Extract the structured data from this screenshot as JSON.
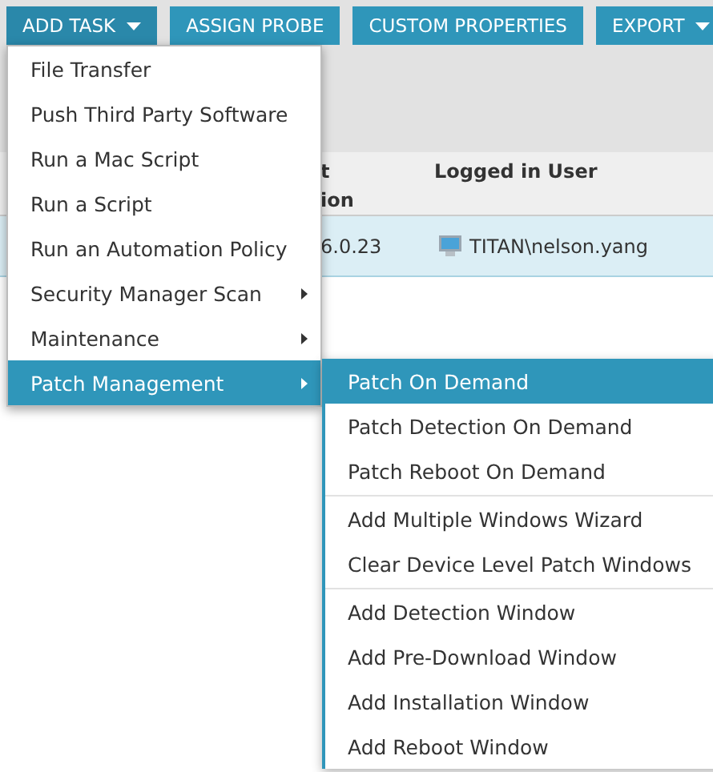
{
  "toolbar": {
    "buttons": [
      {
        "label": "ADD TASK",
        "dropdown": true,
        "open": true
      },
      {
        "label": "ASSIGN PROBE",
        "dropdown": false,
        "open": false
      },
      {
        "label": "CUSTOM PROPERTIES",
        "dropdown": false,
        "open": false
      },
      {
        "label": "EXPORT",
        "dropdown": true,
        "open": false
      }
    ]
  },
  "table": {
    "columns": [
      {
        "label": "t\nion"
      },
      {
        "label": "Logged in User"
      }
    ],
    "rows": [
      {
        "selected": true,
        "cells": [
          "6.0.23",
          "TITAN\\nelson.yang"
        ]
      }
    ]
  },
  "menu": {
    "items": [
      {
        "label": "File Transfer",
        "submenu": false,
        "selected": false
      },
      {
        "label": "Push Third Party Software",
        "submenu": false,
        "selected": false
      },
      {
        "label": "Run a Mac Script",
        "submenu": false,
        "selected": false
      },
      {
        "label": "Run a Script",
        "submenu": false,
        "selected": false
      },
      {
        "label": "Run an Automation Policy",
        "submenu": false,
        "selected": false
      },
      {
        "label": "Security Manager Scan",
        "submenu": true,
        "selected": false
      },
      {
        "label": "Maintenance",
        "submenu": true,
        "selected": false
      },
      {
        "label": "Patch Management",
        "submenu": true,
        "selected": true
      }
    ]
  },
  "submenu": {
    "items": [
      {
        "label": "Patch On Demand",
        "selected": true,
        "separator_after": false
      },
      {
        "label": "Patch Detection On Demand",
        "selected": false,
        "separator_after": false
      },
      {
        "label": "Patch Reboot On Demand",
        "selected": false,
        "separator_after": true
      },
      {
        "label": "Add Multiple Windows Wizard",
        "selected": false,
        "separator_after": false
      },
      {
        "label": "Clear Device Level Patch Windows",
        "selected": false,
        "separator_after": true
      },
      {
        "label": "Add Detection Window",
        "selected": false,
        "separator_after": false
      },
      {
        "label": "Add Pre-Download Window",
        "selected": false,
        "separator_after": false
      },
      {
        "label": "Add Installation Window",
        "selected": false,
        "separator_after": false
      },
      {
        "label": "Add Reboot Window",
        "selected": false,
        "separator_after": false
      }
    ]
  }
}
